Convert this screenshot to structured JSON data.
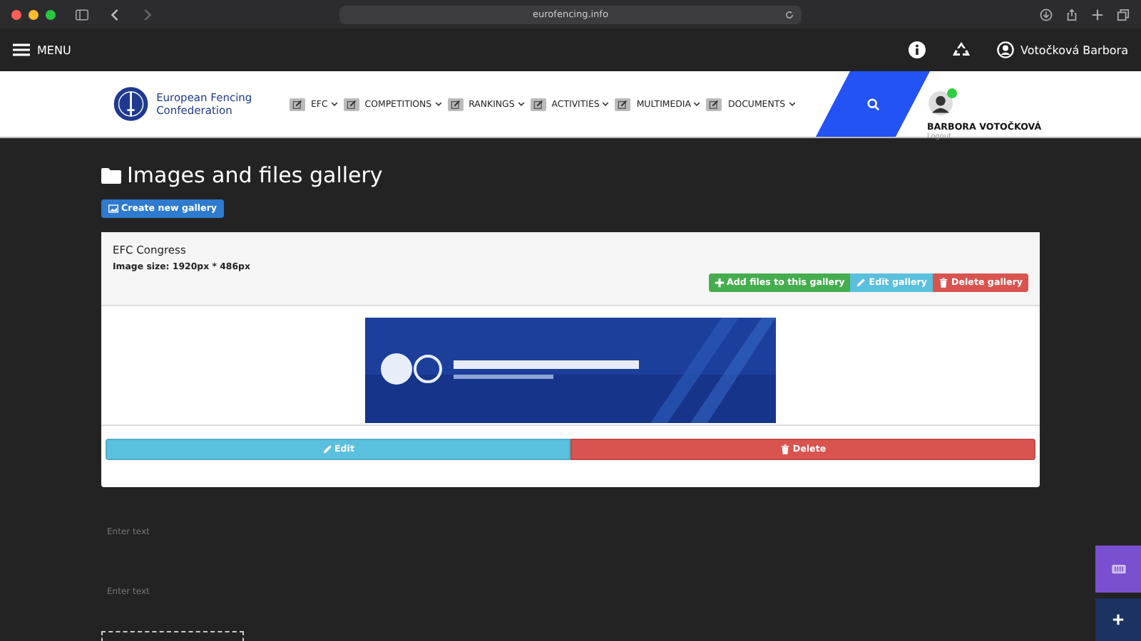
{
  "browser": {
    "url": "eurofencing.info"
  },
  "topbar": {
    "menu_label": "MENU",
    "user_name": "Votočková Barbora"
  },
  "nav": {
    "logo_text": "European Fencing Confederation",
    "items": [
      {
        "label": "EFC"
      },
      {
        "label": "COMPETITIONS"
      },
      {
        "label": "RANKINGS"
      },
      {
        "label": "ACTIVITIES"
      },
      {
        "label": "MULTIMEDIA"
      },
      {
        "label": "DOCUMENTS"
      }
    ],
    "user": {
      "name": "BARBORA VOTOČKOVÁ",
      "logout": "Logout",
      "online": true
    }
  },
  "page": {
    "title": "Images and files gallery",
    "create_button": "Create new gallery"
  },
  "gallery": {
    "name": "EFC Congress",
    "image_size": "Image size: 1920px * 486px",
    "actions": [
      {
        "label": "Add files to this gallery",
        "kind": "add"
      },
      {
        "label": "Edit gallery",
        "kind": "edit"
      },
      {
        "label": "Delete gallery",
        "kind": "delete"
      }
    ],
    "item_actions": [
      {
        "label": "Edit",
        "kind": "edit"
      },
      {
        "label": "Delete",
        "kind": "delete"
      }
    ]
  },
  "editor": {
    "fields": [
      {
        "placeholder": "Enter text"
      },
      {
        "placeholder": "Enter text"
      }
    ]
  }
}
